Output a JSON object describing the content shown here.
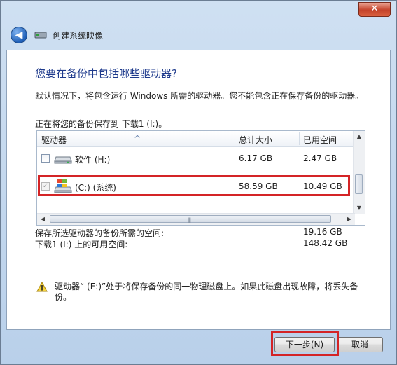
{
  "titlebar": {
    "close_glyph": "✕"
  },
  "nav": {
    "back_glyph": "◀",
    "title": "创建系统映像"
  },
  "heading": "您要在备份中包括哪些驱动器?",
  "description": "默认情况下，将包含运行 Windows 所需的驱动器。您不能包含正在保存备份的驱动器。",
  "save_to": "正在将您的备份保存到 下载1 (I:)。",
  "table": {
    "columns": [
      "驱动器",
      "总计大小",
      "已用空间"
    ],
    "rows": [
      {
        "name": "软件 (H:)",
        "total": "6.17 GB",
        "used": "2.47 GB",
        "checked": false,
        "icon": "drive-icon"
      },
      {
        "name": "(C:) (系统)",
        "total": "58.59 GB",
        "used": "10.49 GB",
        "checked": true,
        "icon": "windows-drive-icon"
      }
    ]
  },
  "summary": {
    "required_label": "保存所选驱动器的备份所需的空间:",
    "required_value": "19.16 GB",
    "available_label": "下载1 (I:) 上的可用空间:",
    "available_value": "148.42 GB"
  },
  "warning": {
    "icon": "warning-icon",
    "text": "驱动器“ (E:)”处于将保存备份的同一物理磁盘上。如果此磁盘出现故障，将丢失备份。"
  },
  "buttons": {
    "next": "下一步(N)",
    "cancel": "取消"
  },
  "colors": {
    "heading": "#1e3a8c",
    "highlight": "#d42426"
  }
}
